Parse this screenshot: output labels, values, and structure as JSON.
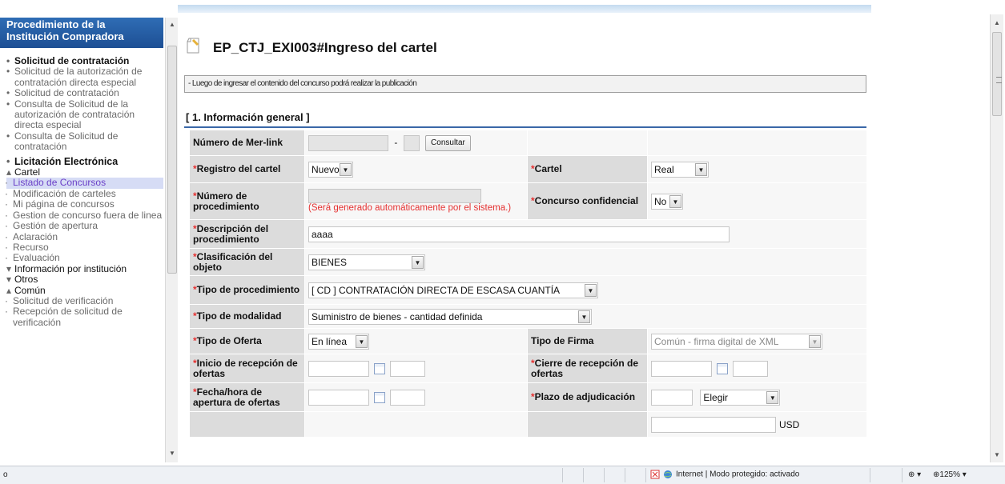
{
  "sidebar": {
    "header_line1": "Procedimiento de la",
    "header_line2": "Institución Compradora",
    "items": [
      {
        "label": "Solicitud de contratación"
      },
      {
        "label": "Solicitud de la autorización de contratación directa especial"
      },
      {
        "label": "Solicitud de contratación"
      },
      {
        "label": "Consulta de Solicitud de la autorización de contratación directa especial"
      },
      {
        "label": "Consulta de Solicitud de contratación"
      },
      {
        "label": "Licitación Electrónica"
      },
      {
        "label": "Cartel"
      },
      {
        "label": "Listado de Concursos"
      },
      {
        "label": "Modificación de carteles"
      },
      {
        "label": "Mi página de concursos"
      },
      {
        "label": "Gestion de concurso fuera de linea"
      },
      {
        "label": "Gestión de apertura"
      },
      {
        "label": "Aclaración"
      },
      {
        "label": "Recurso"
      },
      {
        "label": "Evaluación"
      },
      {
        "label": "Información por institución"
      },
      {
        "label": "Otros"
      },
      {
        "label": "Común"
      },
      {
        "label": "Solicitud de verificación"
      },
      {
        "label": "Recepción de solicitud de verificación"
      }
    ]
  },
  "main": {
    "title": "EP_CTJ_EXI003#Ingreso del cartel",
    "info": "- Luego de ingresar el contenido del concurso podrá realizar la publicación",
    "section": "[ 1. Información general ]",
    "form": {
      "merlink": {
        "label": "Número de Mer-link",
        "dash": "-",
        "button": "Consultar"
      },
      "registro": {
        "req": "*",
        "label": "Registro del cartel",
        "value": "Nuevo"
      },
      "cartel": {
        "req": "*",
        "label": "Cartel",
        "value": "Real"
      },
      "numero": {
        "req": "*",
        "label": "Número de procedimiento",
        "note": "(Será generado automáticamente por el sistema.)"
      },
      "confidencial": {
        "req": "*",
        "label": "Concurso confidencial",
        "value": "No"
      },
      "descripcion": {
        "req": "*",
        "label": "Descripción del procedimiento",
        "value": "aaaa"
      },
      "clasificacion": {
        "req": "*",
        "label": "Clasificación del objeto",
        "value": "BIENES"
      },
      "tipo_proc": {
        "req": "*",
        "label": "Tipo de procedimiento",
        "value": "[ CD ] CONTRATACIÓN DIRECTA DE ESCASA CUANTÍA"
      },
      "modalidad": {
        "req": "*",
        "label": "Tipo de modalidad",
        "value": "Suministro de bienes - cantidad definida"
      },
      "oferta": {
        "req": "*",
        "label": "Tipo de Oferta",
        "value": "En línea"
      },
      "firma": {
        "label": "Tipo de Firma",
        "value": "Común - firma digital de XML"
      },
      "inicio": {
        "req": "*",
        "label": "Inicio de recepción de ofertas"
      },
      "cierre": {
        "req": "*",
        "label": "Cierre de recepción de ofertas"
      },
      "apertura": {
        "req": "*",
        "label": "Fecha/hora de apertura de ofertas"
      },
      "plazo": {
        "req": "*",
        "label": "Plazo de adjudicación",
        "value": "Elegir"
      },
      "usd": "USD"
    }
  },
  "statusbar": {
    "left": "o",
    "zone": "Internet | Modo protegido: activado",
    "view": "⊕ ▾",
    "zoom": "⊕125%  ▾"
  }
}
